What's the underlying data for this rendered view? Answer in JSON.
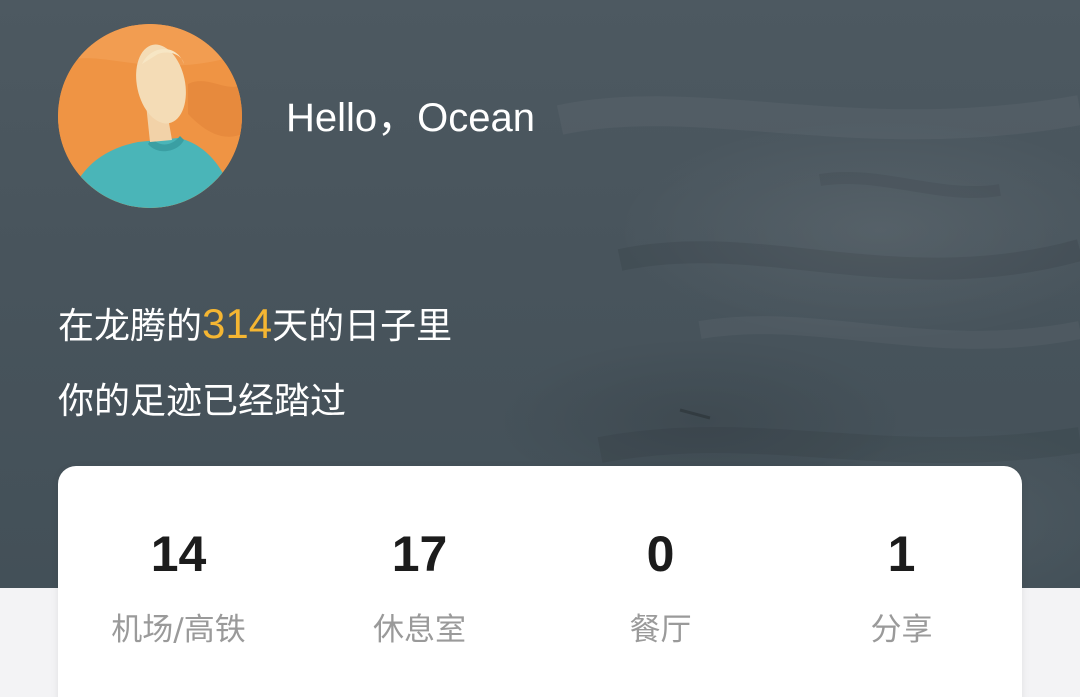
{
  "profile": {
    "greeting": "Hello，Ocean",
    "avatar_icon": "user-avatar-illustration"
  },
  "summary": {
    "prefix": "在龙腾的",
    "days": "314",
    "suffix": "天的日子里",
    "subtitle": "你的足迹已经踏过"
  },
  "stats": [
    {
      "value": "14",
      "label": "机场/高铁"
    },
    {
      "value": "17",
      "label": "休息室"
    },
    {
      "value": "0",
      "label": "餐厅"
    },
    {
      "value": "1",
      "label": "分享"
    }
  ],
  "colors": {
    "hero_background": "#48545c",
    "highlight": "#f5b632",
    "avatar_background": "#ef9444",
    "card_background": "#ffffff",
    "label_text": "#9a9a9a"
  }
}
